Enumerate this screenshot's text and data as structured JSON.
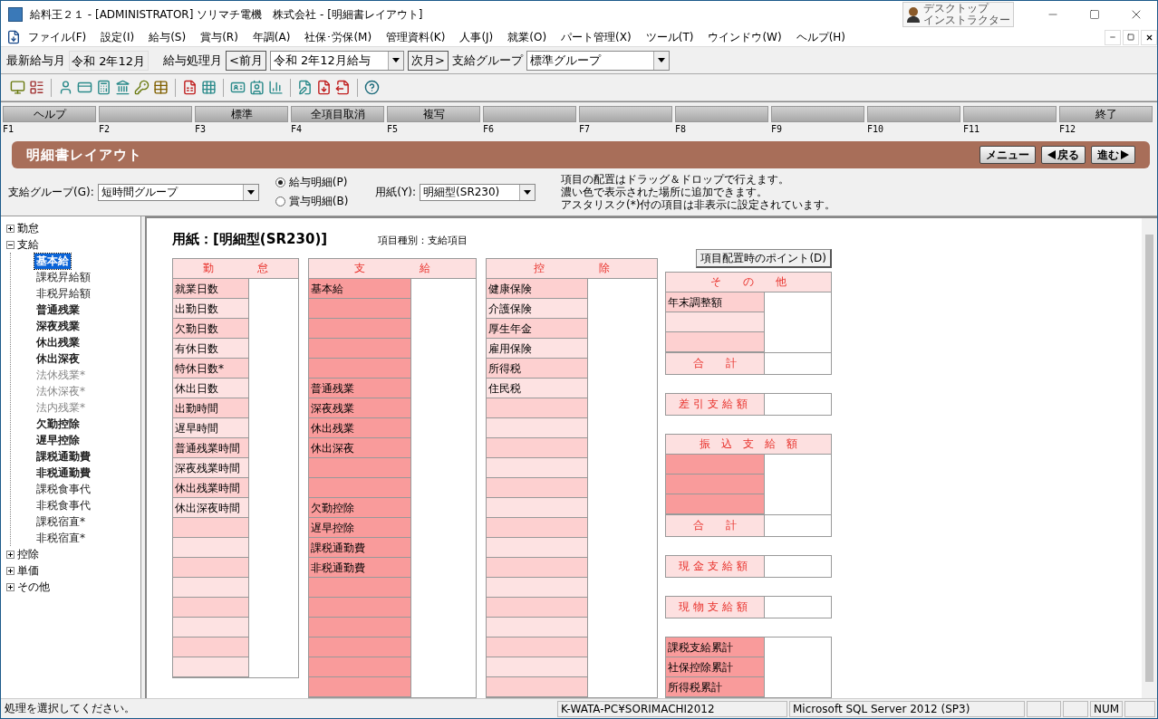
{
  "window": {
    "title": "給料王２１ - [ADMINISTRATOR] ソリマチ電機　株式会社 - [明細書レイアウト]",
    "assistant": [
      "デスクトップ",
      "インストラクター"
    ]
  },
  "menu": [
    "ファイル(F)",
    "設定(I)",
    "給与(S)",
    "賞与(R)",
    "年調(A)",
    "社保･労保(M)",
    "管理資料(K)",
    "人事(J)",
    "就業(O)",
    "パート管理(X)",
    "ツール(T)",
    "ウインドウ(W)",
    "ヘルプ(H)"
  ],
  "info_bar": {
    "latest_label": "最新給与月",
    "latest_value": "令和  2年12月",
    "period_label": "給与処理月",
    "prev_button": "<前月",
    "period_value": "令和  2年12月給与",
    "next_button": "次月>",
    "group_label": "支給グループ",
    "group_value": "標準グループ"
  },
  "function_keys": [
    {
      "key": "F1",
      "label": "ヘルプ"
    },
    {
      "key": "F2"
    },
    {
      "key": "F3",
      "label": "標準"
    },
    {
      "key": "F4",
      "label": "全項目取消"
    },
    {
      "key": "F5",
      "label": "複写"
    },
    {
      "key": "F6"
    },
    {
      "key": "F7"
    },
    {
      "key": "F8"
    },
    {
      "key": "F9"
    },
    {
      "key": "F10"
    },
    {
      "key": "F11"
    },
    {
      "key": "F12",
      "label": "終了"
    }
  ],
  "screen": {
    "title": "明細書レイアウト",
    "nav_buttons": [
      {
        "kind": "menu",
        "label": "メニュー"
      },
      {
        "kind": "back",
        "label": "戻る"
      },
      {
        "kind": "forward",
        "label": "進む"
      }
    ]
  },
  "options": {
    "group_label": "支給グループ(G):",
    "group_value": "短時間グループ",
    "statement_types": [
      {
        "label": "給与明細(P)",
        "selected": true
      },
      {
        "label": "賞与明細(B)",
        "selected": false
      }
    ],
    "paper_label": "用紙(Y):",
    "paper_value": "明細型(SR230)",
    "notes": [
      "項目の配置はドラッグ＆ドロップで行えます。",
      "濃い色で表示された場所に追加できます。",
      "アスタリスク(*)付の項目は非表示に設定されています。"
    ]
  },
  "tree": [
    {
      "label": "勤怠",
      "expanded": false
    },
    {
      "label": "支給",
      "expanded": true,
      "children": [
        {
          "label": "基本給",
          "kind": "placed",
          "selected": true
        },
        {
          "label": "課税昇給額",
          "kind": "available",
          "selected": false
        },
        {
          "label": "非税昇給額",
          "kind": "available",
          "selected": false
        },
        {
          "label": "普通残業",
          "kind": "placed",
          "selected": false
        },
        {
          "label": "深夜残業",
          "kind": "placed",
          "selected": false
        },
        {
          "label": "休出残業",
          "kind": "placed",
          "selected": false
        },
        {
          "label": "休出深夜",
          "kind": "placed",
          "selected": false
        },
        {
          "label": "法休残業*",
          "kind": "hidden",
          "selected": false
        },
        {
          "label": "法休深夜*",
          "kind": "hidden",
          "selected": false
        },
        {
          "label": "法内残業*",
          "kind": "hidden",
          "selected": false
        },
        {
          "label": "欠勤控除",
          "kind": "placed",
          "selected": false
        },
        {
          "label": "遅早控除",
          "kind": "placed",
          "selected": false
        },
        {
          "label": "課税通勤費",
          "kind": "placed",
          "selected": false
        },
        {
          "label": "非税通勤費",
          "kind": "placed",
          "selected": false
        },
        {
          "label": "課税食事代",
          "kind": "available",
          "selected": false
        },
        {
          "label": "非税食事代",
          "kind": "available",
          "selected": false
        },
        {
          "label": "課税宿直*",
          "kind": "available",
          "selected": false
        },
        {
          "label": "非税宿直*",
          "kind": "available",
          "selected": false
        }
      ]
    },
    {
      "label": "控除",
      "expanded": false
    },
    {
      "label": "単価",
      "expanded": false
    },
    {
      "label": "その他",
      "expanded": false
    }
  ],
  "layout": {
    "paper_title": "用紙：[明細型(SR230)]",
    "item_type": "項目種別：支給項目",
    "tips_button": "項目配置時のポイント(D)",
    "columns": [
      {
        "title": "勤　　　　怠",
        "alternating": true,
        "rows": [
          {
            "kind": "item",
            "label": "就業日数"
          },
          {
            "kind": "item",
            "label": "出勤日数"
          },
          {
            "kind": "item",
            "label": "欠勤日数"
          },
          {
            "kind": "item",
            "label": "有休日数"
          },
          {
            "kind": "item",
            "label": "特休日数*"
          },
          {
            "kind": "item",
            "label": "休出日数"
          },
          {
            "kind": "item",
            "label": "出勤時間"
          },
          {
            "kind": "item",
            "label": "遅早時間"
          },
          {
            "kind": "item",
            "label": "普通残業時間"
          },
          {
            "kind": "item",
            "label": "深夜残業時間"
          },
          {
            "kind": "item",
            "label": "休出残業時間"
          },
          {
            "kind": "item",
            "label": "休出深夜時間"
          },
          {
            "kind": "blank"
          },
          {
            "kind": "blank"
          },
          {
            "kind": "blank"
          },
          {
            "kind": "blank"
          },
          {
            "kind": "blank"
          },
          {
            "kind": "blank"
          },
          {
            "kind": "blank"
          },
          {
            "kind": "blank"
          }
        ]
      },
      {
        "title": "支　　　　　給",
        "alternating": false,
        "rows": [
          {
            "kind": "item",
            "label": "基本給"
          },
          {
            "kind": "blank"
          },
          {
            "kind": "blank"
          },
          {
            "kind": "blank"
          },
          {
            "kind": "blank"
          },
          {
            "kind": "item",
            "label": "普通残業"
          },
          {
            "kind": "item",
            "label": "深夜残業"
          },
          {
            "kind": "item",
            "label": "休出残業"
          },
          {
            "kind": "item",
            "label": "休出深夜"
          },
          {
            "kind": "blank"
          },
          {
            "kind": "blank"
          },
          {
            "kind": "item",
            "label": "欠勤控除"
          },
          {
            "kind": "item",
            "label": "遅早控除"
          },
          {
            "kind": "item",
            "label": "課税通勤費"
          },
          {
            "kind": "item",
            "label": "非税通勤費"
          },
          {
            "kind": "blank"
          },
          {
            "kind": "blank"
          },
          {
            "kind": "blank"
          },
          {
            "kind": "blank"
          },
          {
            "kind": "blank"
          },
          {
            "kind": "blank"
          }
        ]
      },
      {
        "title": "控　　　　　除",
        "alternating": true,
        "rows": [
          {
            "kind": "item",
            "label": "健康保険"
          },
          {
            "kind": "item",
            "label": "介護保険"
          },
          {
            "kind": "item",
            "label": "厚生年金"
          },
          {
            "kind": "item",
            "label": "雇用保険"
          },
          {
            "kind": "item",
            "label": "所得税"
          },
          {
            "kind": "item",
            "label": "住民税"
          },
          {
            "kind": "blank"
          },
          {
            "kind": "blank"
          },
          {
            "kind": "blank"
          },
          {
            "kind": "blank"
          },
          {
            "kind": "blank"
          },
          {
            "kind": "blank"
          },
          {
            "kind": "blank"
          },
          {
            "kind": "blank"
          },
          {
            "kind": "blank"
          },
          {
            "kind": "blank"
          },
          {
            "kind": "blank"
          },
          {
            "kind": "blank"
          },
          {
            "kind": "blank"
          },
          {
            "kind": "blank"
          },
          {
            "kind": "blank"
          }
        ]
      }
    ],
    "side_panels": [
      {
        "kind": "group",
        "title": "そ　　の　　他",
        "alternating": true,
        "rows": [
          {
            "kind": "item",
            "label": "年末調整額"
          },
          {
            "kind": "blank"
          },
          {
            "kind": "blank"
          }
        ],
        "total": "合　　計"
      },
      {
        "kind": "single",
        "label": "差引支給額"
      },
      {
        "kind": "group",
        "title": "振　込　支　給　額",
        "alternating": false,
        "rows": [
          {
            "kind": "blank"
          },
          {
            "kind": "blank"
          },
          {
            "kind": "blank"
          }
        ],
        "total": "合　　計"
      },
      {
        "kind": "single",
        "label": "現金支給額"
      },
      {
        "kind": "single",
        "label": "現物支給額"
      },
      {
        "kind": "list",
        "alternating": false,
        "rows": [
          {
            "kind": "item",
            "label": "課税支給累計"
          },
          {
            "kind": "item",
            "label": "社保控除累計"
          },
          {
            "kind": "item",
            "label": "所得税累計"
          }
        ]
      }
    ]
  },
  "status_bar": {
    "message": "処理を選択してください。",
    "panes": [
      {
        "kind": "text",
        "text": "K-WATA-PC¥SORIMACHI2012"
      },
      {
        "kind": "text",
        "text": "Microsoft SQL Server 2012 (SP3)"
      },
      {
        "kind": "blank"
      },
      {
        "kind": "blank"
      },
      {
        "kind": "text",
        "text": "NUM"
      },
      {
        "kind": "blank"
      }
    ]
  }
}
